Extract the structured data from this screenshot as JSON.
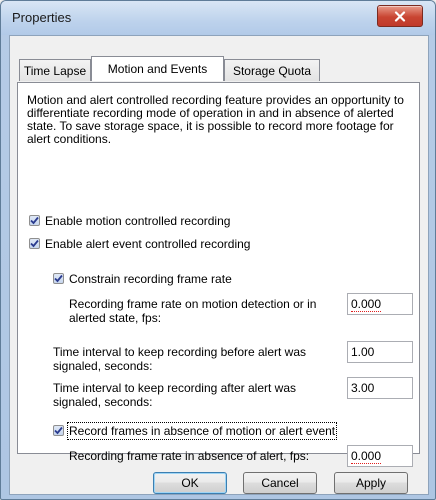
{
  "window": {
    "title": "Properties"
  },
  "tabs": [
    {
      "label": "Time Lapse"
    },
    {
      "label": "Motion and Events"
    },
    {
      "label": "Storage Quota"
    }
  ],
  "description": "Motion and alert controlled recording feature provides an opportunity to differentiate recording mode of operation in and in absence of alerted state. To save storage space, it is possible to record more footage for alert conditions.",
  "options": {
    "enable_motion": {
      "label": "Enable motion controlled recording",
      "checked": true
    },
    "enable_alert": {
      "label": "Enable alert event controlled recording",
      "checked": true
    },
    "constrain_rate": {
      "label": "Constrain recording frame rate",
      "checked": true
    },
    "record_absence": {
      "label": "Record frames in absence of motion or alert event",
      "checked": true
    }
  },
  "fields": {
    "motion_rate": {
      "label": "Recording frame rate on motion detection or in alerted state, fps:",
      "value": "0.000"
    },
    "before_alert": {
      "label": "Time interval to keep recording before alert was signaled, seconds:",
      "value": "1.00"
    },
    "after_alert": {
      "label": "Time interval to keep recording after alert was signaled, seconds:",
      "value": "3.00"
    },
    "absence_rate": {
      "label": "Recording frame rate in absence of alert, fps:",
      "value": "0.000"
    }
  },
  "buttons": {
    "ok": "OK",
    "cancel": "Cancel",
    "apply": "Apply"
  }
}
